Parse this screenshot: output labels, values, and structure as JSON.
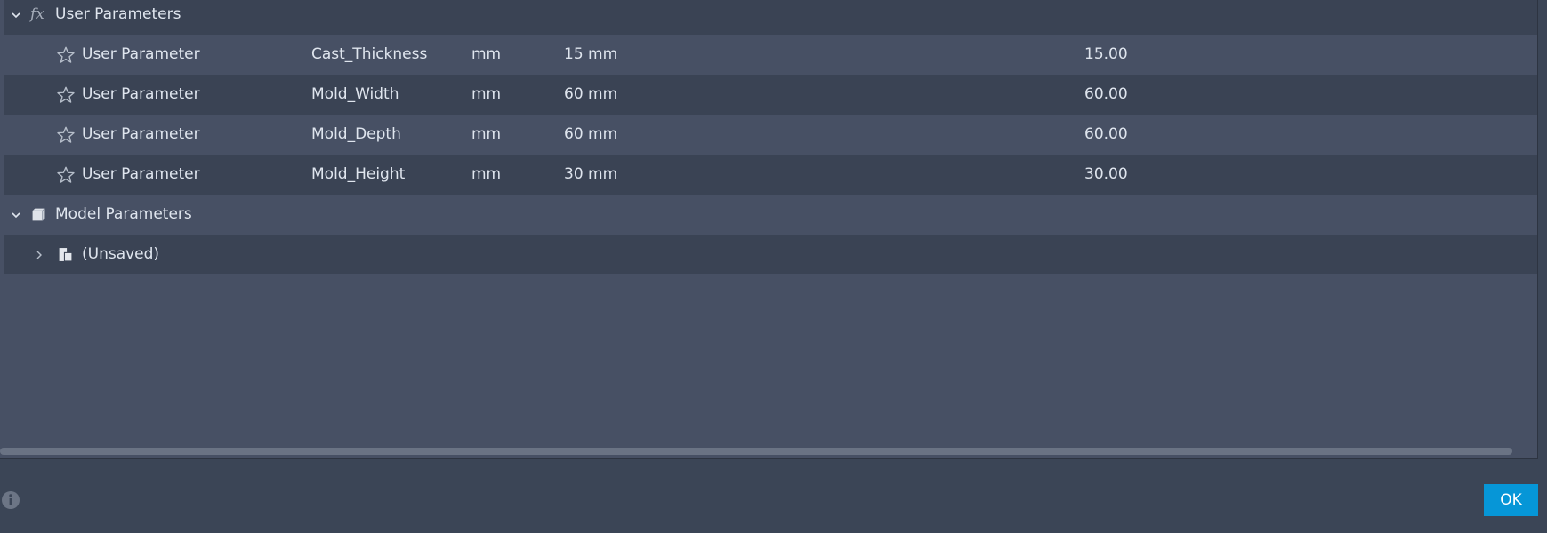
{
  "groups": {
    "user": {
      "label": "User Parameters",
      "icon": "fx-icon",
      "icon_text": "fx"
    },
    "model": {
      "label": "Model Parameters",
      "icon": "cube-icon"
    }
  },
  "user_parameters": [
    {
      "type": "User Parameter",
      "name": "Cast_Thickness",
      "unit": "mm",
      "expression": "15 mm",
      "value": "15.00"
    },
    {
      "type": "User Parameter",
      "name": "Mold_Width",
      "unit": "mm",
      "expression": "60 mm",
      "value": "60.00"
    },
    {
      "type": "User Parameter",
      "name": "Mold_Depth",
      "unit": "mm",
      "expression": "60 mm",
      "value": "60.00"
    },
    {
      "type": "User Parameter",
      "name": "Mold_Height",
      "unit": "mm",
      "expression": "30 mm",
      "value": "30.00"
    }
  ],
  "model_items": [
    {
      "label": "(Unsaved)",
      "icon": "component-icon"
    }
  ],
  "footer": {
    "ok_label": "OK",
    "info_icon": "info-icon"
  },
  "colors": {
    "accent": "#0696d7",
    "panel_bg": "#475064",
    "row_dark": "#3a4354"
  }
}
